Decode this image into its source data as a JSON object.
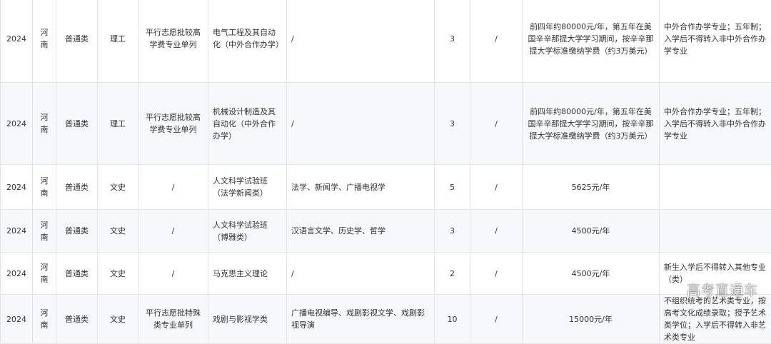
{
  "rows": [
    {
      "year": "2024",
      "province": "河南",
      "category": "普通类",
      "subject": "理工",
      "batch": "平行志愿批较高学费专业单列",
      "major": "电气工程及其自动化（中外合作办学）",
      "includes": "/",
      "plan": "3",
      "note1": "/",
      "fee": "前四年约80000元/年，第五年在美国辛辛那提大学学习期间，按辛辛那提大学标准缴纳学费（约3万美元）",
      "remark": "中外合作办学专业；五年制；入学后不得转入非中外合作办学专业"
    },
    {
      "year": "2024",
      "province": "河南",
      "category": "普通类",
      "subject": "理工",
      "batch": "平行志愿批较高学费专业单列",
      "major": "机械设计制造及其自动化（中外合作办学）",
      "includes": "/",
      "plan": "3",
      "note1": "/",
      "fee": "前四年约80000元/年，第五年在美国辛辛那提大学学习期间，按辛辛那提大学标准缴纳学费（约3万美元）",
      "remark": "中外合作办学专业；五年制；入学后不得转入非中外合作办学专业"
    },
    {
      "year": "2024",
      "province": "河南",
      "category": "普通类",
      "subject": "文史",
      "batch": "/",
      "major": "人文科学试验班（法学新闻类）",
      "includes": "法学、新闻学、广播电视学",
      "plan": "5",
      "note1": "/",
      "fee": "5625元/年",
      "remark": ""
    },
    {
      "year": "2024",
      "province": "河南",
      "category": "普通类",
      "subject": "文史",
      "batch": "/",
      "major": "人文科学试验班（博雅类）",
      "includes": "汉语言文学、历史学、哲学",
      "plan": "3",
      "note1": "/",
      "fee": "4500元/年",
      "remark": ""
    },
    {
      "year": "2024",
      "province": "河南",
      "category": "普通类",
      "subject": "文史",
      "batch": "/",
      "major": "马克思主义理论",
      "includes": "/",
      "plan": "2",
      "note1": "/",
      "fee": "4500元/年",
      "remark": "新生入学后不得转入其他专业（类）"
    },
    {
      "year": "2024",
      "province": "河南",
      "category": "普通类",
      "subject": "文史",
      "batch": "平行志愿批特殊类专业单列",
      "major": "戏剧与影视学类",
      "includes": "广播电视编导、戏剧影视文学、戏剧影视导演",
      "plan": "10",
      "note1": "/",
      "fee": "15000元/年",
      "remark": "不组织统考的艺术类专业，按高考文化成绩录取；授予艺术类学位；入学后不得转入非艺术类专业"
    }
  ],
  "watermark": "高考直通车"
}
